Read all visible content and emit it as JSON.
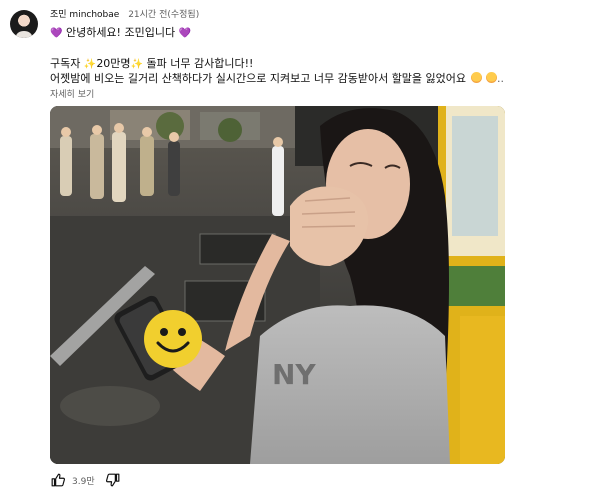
{
  "comment": {
    "author": "조민 minchobae",
    "time": "21시간 전(수정됨)",
    "greeting": "안녕하세요! 조민입니다",
    "body_line1_a": "구독자 ",
    "body_line1_b": "20만명",
    "body_line1_c": " 돌파 너무 감사합니다!!",
    "body_line2": "어젯밤에 비오는 길거리 산책하다가 실시간으로 지켜보고 너무 감동받아서 할말을 잃었어요",
    "more_label": "자세히 보기",
    "like_count": "3.9만"
  },
  "icons": {
    "heart": "purple-heart-icon",
    "sparkle": "sparkles-icon",
    "crying": "crying-face-icon",
    "like": "thumbs-up-icon",
    "dislike": "thumbs-down-icon",
    "phone_sticker": "smiley-face-icon"
  },
  "colors": {
    "heart": "#8a4fc9",
    "sparkle": "#f5b400",
    "secondary_text": "#606060"
  }
}
